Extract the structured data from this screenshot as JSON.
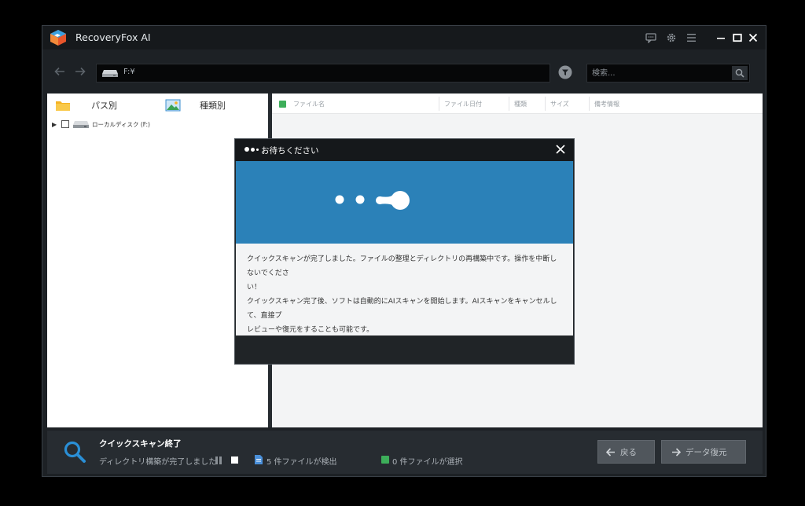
{
  "app": {
    "title": "RecoveryFox AI"
  },
  "toolbar": {
    "path": "F:¥",
    "search_placeholder": "検索..."
  },
  "left_panel": {
    "tabs": [
      {
        "label": "パス別",
        "icon": "folder-icon"
      },
      {
        "label": "種類別",
        "icon": "image-icon"
      }
    ],
    "tree": [
      {
        "label": "ローカルディスク (F:)"
      }
    ]
  },
  "file_list": {
    "columns": [
      "ファイル名",
      "ファイル日付",
      "種類",
      "サイズ",
      "備考情報"
    ]
  },
  "status": {
    "title": "クイックスキャン終了",
    "subtitle": "ディレクトリ構築が完了しました",
    "found": "5 件ファイルが検出",
    "selected": "0 件ファイルが選択",
    "back_label": "戻る",
    "recover_label": "データ復元"
  },
  "dialog": {
    "title": "お待ちください",
    "lines": [
      "クイックスキャンが完了しました。ファイルの整理とディレクトリの再構築中です。操作を中断しないでくださ",
      "い！",
      "クイックスキャン完了後、ソフトは自動的にAIスキャンを開始します。AIスキャンをキャンセルして、直接プ",
      "レビューや復元をすることも可能です。"
    ]
  },
  "colors": {
    "accent_blue": "#2b81b8",
    "check_green": "#3dae5a",
    "window_bg": "#1d2125"
  }
}
